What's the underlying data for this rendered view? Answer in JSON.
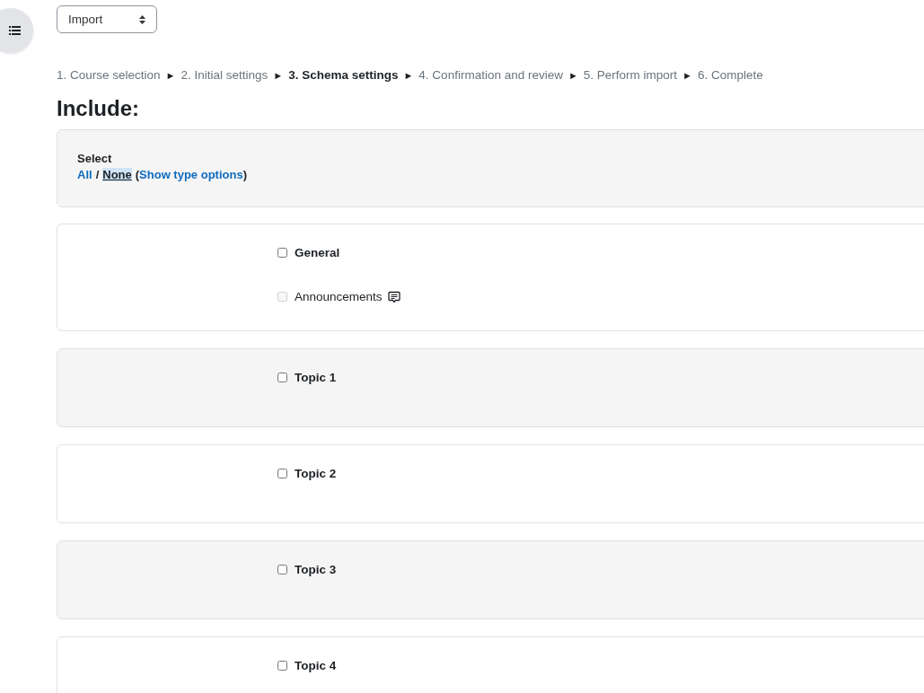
{
  "import_select": {
    "value": "Import"
  },
  "steps": [
    {
      "label": "1. Course selection",
      "current": false
    },
    {
      "label": "2. Initial settings",
      "current": false
    },
    {
      "label": "3. Schema settings",
      "current": true
    },
    {
      "label": "4. Confirmation and review",
      "current": false
    },
    {
      "label": "5. Perform import",
      "current": false
    },
    {
      "label": "6. Complete",
      "current": false
    }
  ],
  "separator": "►",
  "heading": "Include:",
  "select_box": {
    "label": "Select",
    "all": "All",
    "slash": "/",
    "none": "None",
    "open_paren": "(",
    "show_types": "Show type options",
    "close_paren": ")"
  },
  "sections": [
    {
      "title": "General",
      "checked": false,
      "children": [
        {
          "label": "Announcements",
          "checked": false,
          "disabled": true
        }
      ]
    },
    {
      "title": "Topic 1",
      "checked": false
    },
    {
      "title": "Topic 2",
      "checked": false
    },
    {
      "title": "Topic 3",
      "checked": false
    },
    {
      "title": "Topic 4",
      "checked": false
    }
  ]
}
